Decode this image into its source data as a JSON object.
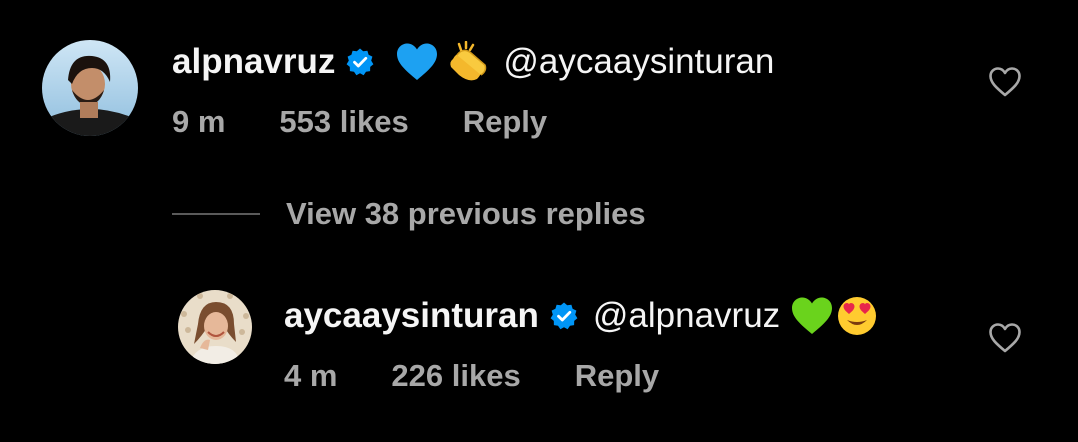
{
  "comment": {
    "username": "alpnavruz",
    "verified": true,
    "text": "@aycaaysinturan",
    "emojis": [
      "blue-heart",
      "clapping-hands"
    ],
    "time": "9 m",
    "likes": "553 likes",
    "reply_label": "Reply"
  },
  "view_replies": {
    "label": "View 38 previous replies"
  },
  "reply": {
    "username": "aycaaysinturan",
    "verified": true,
    "text": "@alpnavruz",
    "emojis": [
      "green-heart",
      "heart-eyes-face"
    ],
    "time": "4 m",
    "likes": "226 likes",
    "reply_label": "Reply"
  },
  "colors": {
    "background": "#000000",
    "primary_text": "#f5f5f5",
    "secondary_text": "#a8a8a8",
    "verified_badge": "#0095f6",
    "blue_heart": "#1da1f2",
    "green_heart": "#6ad31c"
  }
}
